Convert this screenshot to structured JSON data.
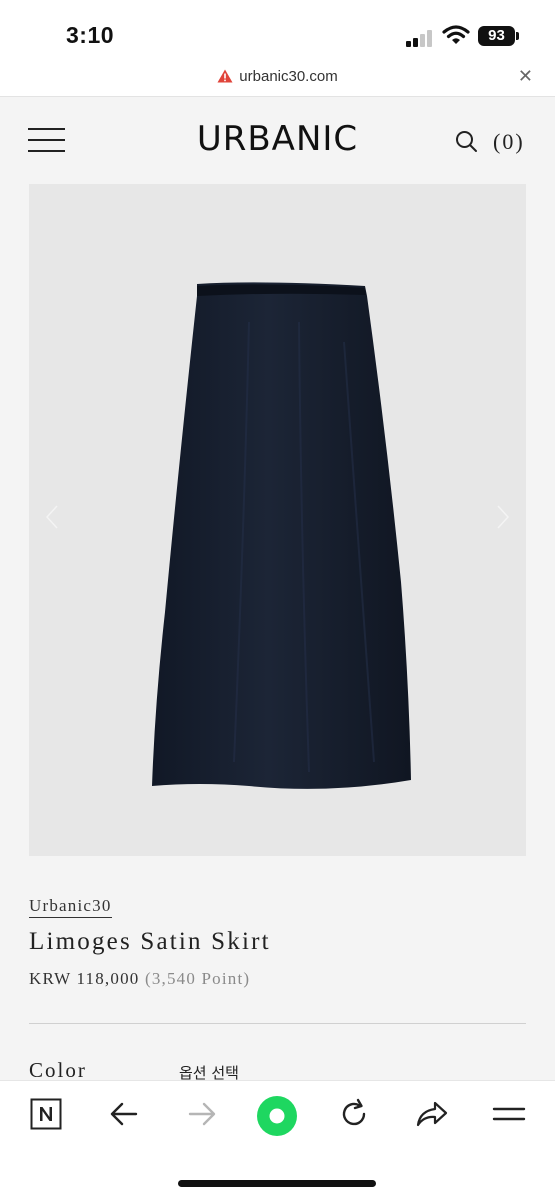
{
  "status_bar": {
    "time": "3:10",
    "battery": "93"
  },
  "browser": {
    "url": "urbanic30.com"
  },
  "header": {
    "logo": "URBANIC",
    "cart_count": "(0)"
  },
  "product": {
    "brand": "Urbanic30",
    "name": "Limoges Satin Skirt",
    "price": "KRW 118,000",
    "points": "(3,540 Point)",
    "color_label": "Color",
    "option_placeholder": "옵션 선택"
  },
  "colors": {
    "page_bg": "#f4f4f4",
    "image_bg": "#e7e7e7",
    "skirt": "#17202e",
    "accent_green": "#1ed760",
    "warning_red": "#e0443a"
  },
  "toolbar": {
    "icons": [
      "naver-n-icon",
      "back-arrow-icon",
      "forward-arrow-icon",
      "green-home-icon",
      "reload-icon",
      "share-icon",
      "menu-icon"
    ]
  }
}
